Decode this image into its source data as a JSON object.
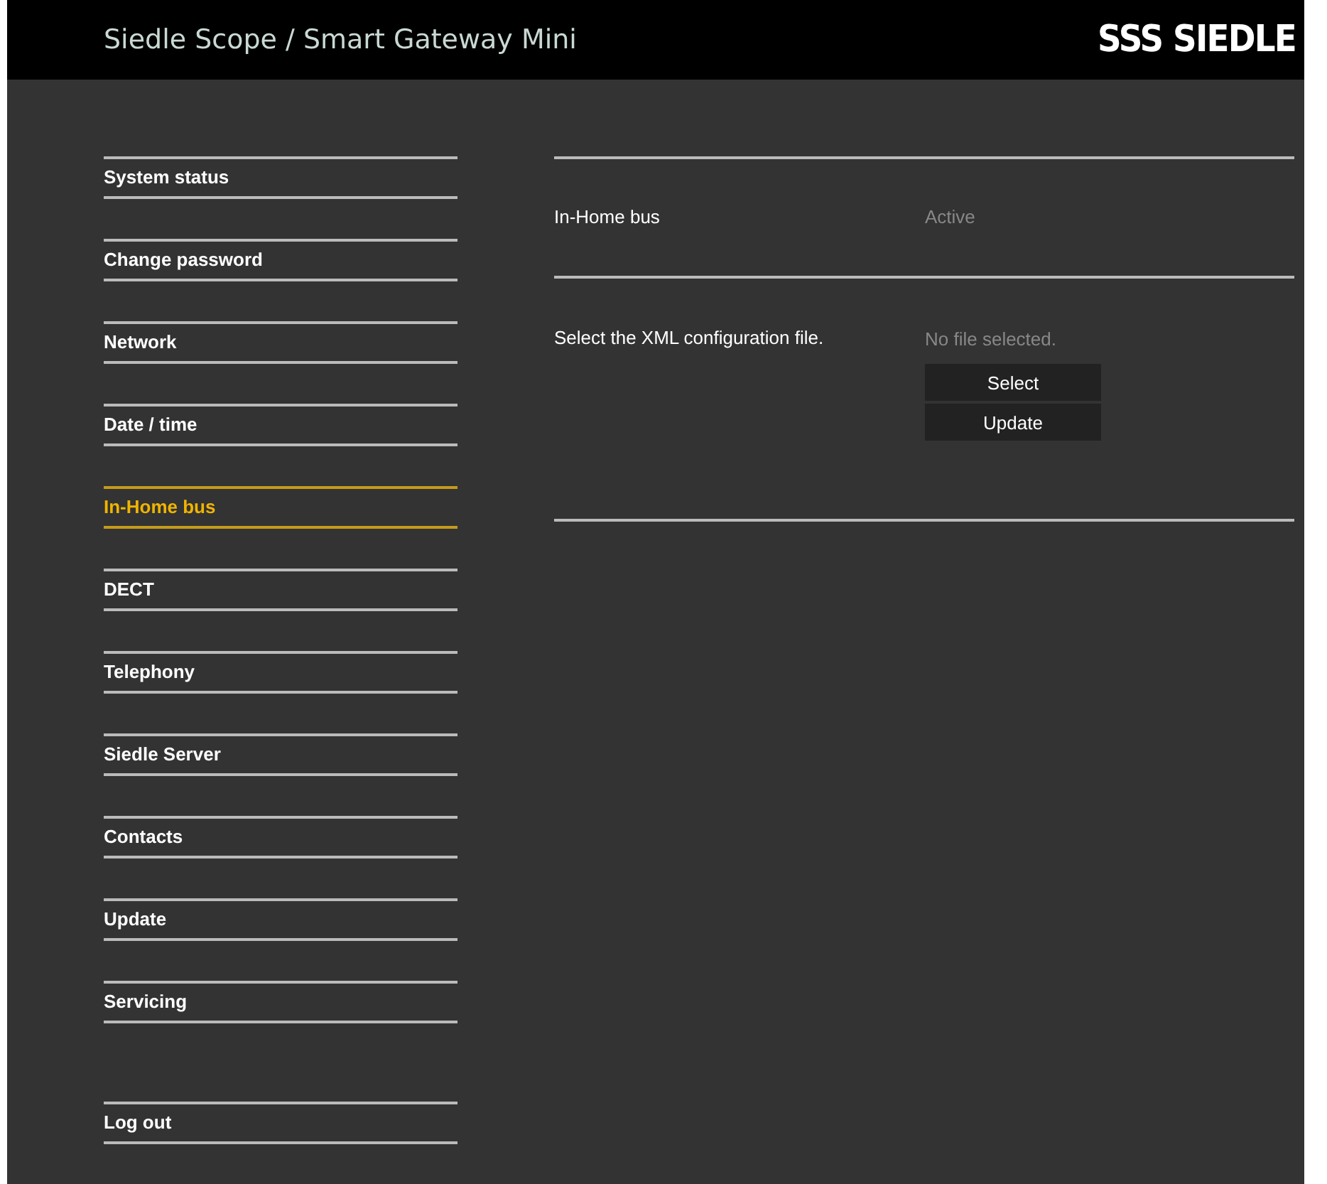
{
  "header": {
    "title": "Siedle Scope / Smart Gateway Mini",
    "logo": "SSS SIEDLE"
  },
  "sidebar": {
    "items": [
      {
        "label": "System status",
        "selected": false
      },
      {
        "label": "Change password",
        "selected": false
      },
      {
        "label": "Network",
        "selected": false
      },
      {
        "label": "Date / time",
        "selected": false
      },
      {
        "label": "In-Home bus",
        "selected": true
      },
      {
        "label": "DECT",
        "selected": false
      },
      {
        "label": "Telephony",
        "selected": false
      },
      {
        "label": "Siedle Server",
        "selected": false
      },
      {
        "label": "Contacts",
        "selected": false
      },
      {
        "label": "Update",
        "selected": false
      },
      {
        "label": "Servicing",
        "selected": false
      }
    ],
    "logout": {
      "label": "Log out",
      "selected": false
    }
  },
  "status": {
    "label": "In-Home bus",
    "value": "Active"
  },
  "config": {
    "label": "Select the XML configuration file.",
    "file": "No file selected.",
    "buttons": [
      "Select",
      "Update"
    ]
  }
}
